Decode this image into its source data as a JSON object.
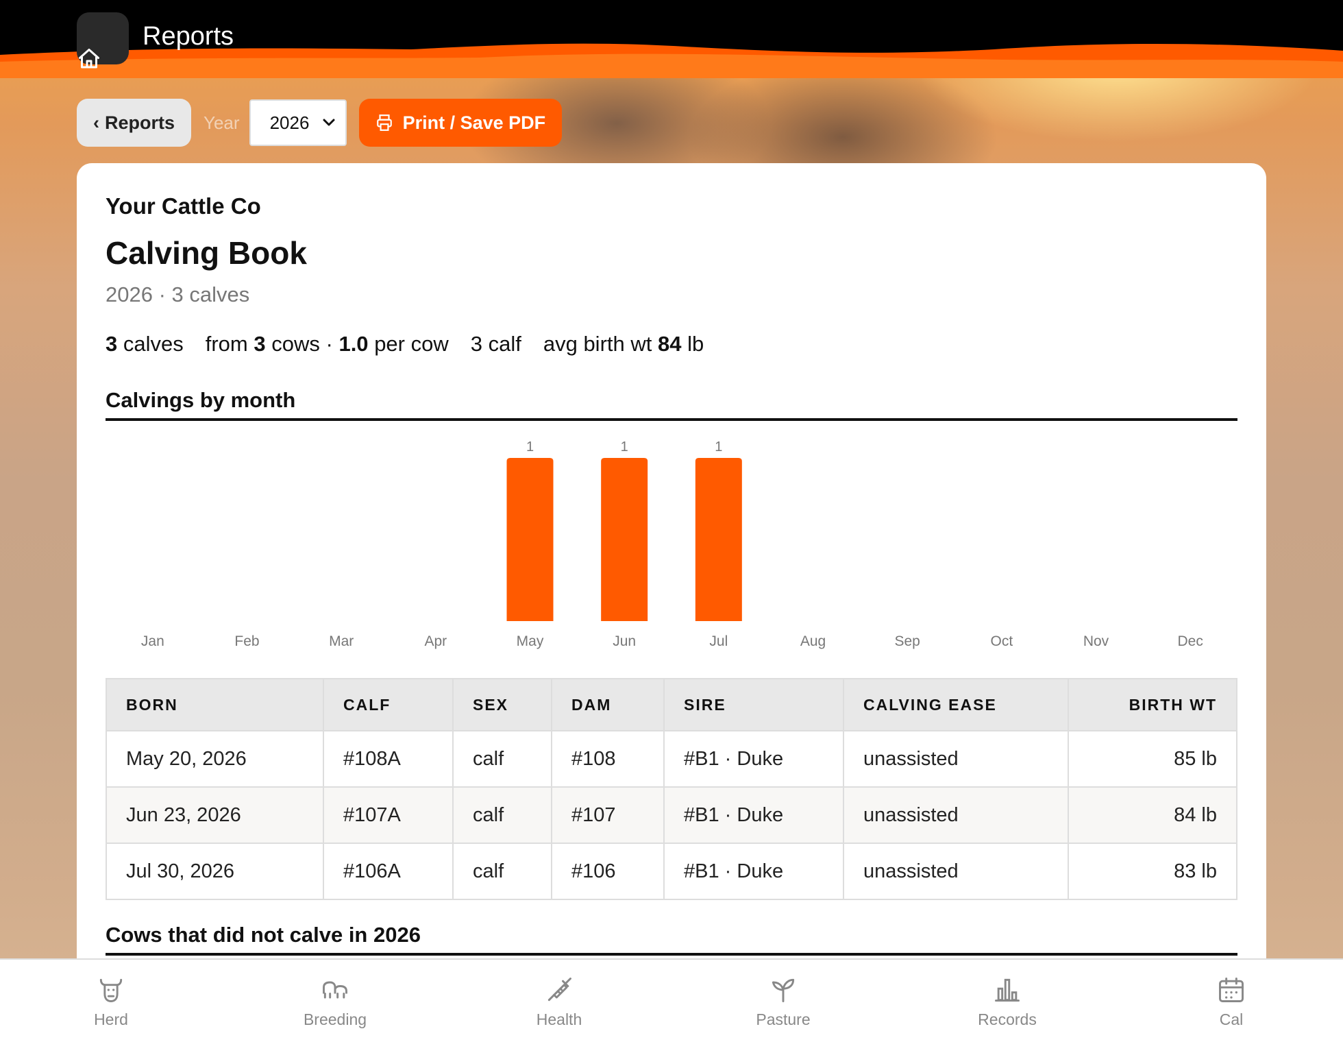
{
  "header": {
    "title": "Reports"
  },
  "toolbar": {
    "back_label": "Reports",
    "year_label": "Year",
    "year_value": "2026",
    "print_label": "Print / Save PDF"
  },
  "report": {
    "company": "Your Cattle Co",
    "title": "Calving Book",
    "subtitle": "2026 · 3 calves",
    "stats": {
      "calves_count": "3",
      "calves_word": "calves",
      "from_word": "from",
      "cows_count": "3",
      "cows_word": "cows ·",
      "per_cow": "1.0",
      "per_cow_word": "per cow",
      "calf_summary": "3 calf",
      "avg_label": "avg birth wt",
      "avg_value": "84",
      "avg_unit": "lb"
    },
    "chart_section_title": "Calvings by month",
    "table_headers": [
      "BORN",
      "CALF",
      "SEX",
      "DAM",
      "SIRE",
      "CALVING EASE",
      "BIRTH WT"
    ],
    "rows": [
      [
        "May 20, 2026",
        "#108A",
        "calf",
        "#108",
        "#B1 · Duke",
        "unassisted",
        "85 lb"
      ],
      [
        "Jun 23, 2026",
        "#107A",
        "calf",
        "#107",
        "#B1 · Duke",
        "unassisted",
        "84 lb"
      ],
      [
        "Jul 30, 2026",
        "#106A",
        "calf",
        "#106",
        "#B1 · Duke",
        "unassisted",
        "83 lb"
      ]
    ],
    "not_calved_title": "Cows that did not calve in 2026"
  },
  "chart_data": {
    "type": "bar",
    "categories": [
      "Jan",
      "Feb",
      "Mar",
      "Apr",
      "May",
      "Jun",
      "Jul",
      "Aug",
      "Sep",
      "Oct",
      "Nov",
      "Dec"
    ],
    "values": [
      0,
      0,
      0,
      0,
      1,
      1,
      1,
      0,
      0,
      0,
      0,
      0
    ],
    "title": "Calvings by month",
    "ylim": [
      0,
      1
    ],
    "bar_color": "#ff5a00",
    "grid": false
  },
  "nav": {
    "items": [
      {
        "label": "Herd",
        "icon": "cow-icon"
      },
      {
        "label": "Breeding",
        "icon": "breeding-icon"
      },
      {
        "label": "Health",
        "icon": "syringe-icon"
      },
      {
        "label": "Pasture",
        "icon": "sprout-icon"
      },
      {
        "label": "Records",
        "icon": "bar-chart-icon"
      },
      {
        "label": "Cal",
        "icon": "calendar-icon"
      }
    ]
  },
  "colors": {
    "accent": "#ff5a00",
    "header_bg": "#000000"
  }
}
